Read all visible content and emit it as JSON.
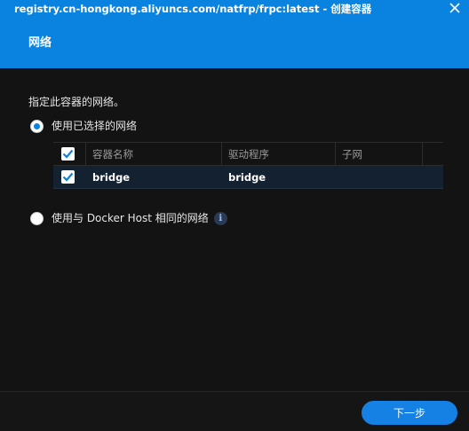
{
  "window": {
    "title": "registry.cn-hongkong.aliyuncs.com/natfrp/frpc:latest - 创建容器",
    "close_glyph": "×"
  },
  "section": {
    "title": "网络"
  },
  "content": {
    "description": "指定此容器的网络。",
    "option_selected_network": "使用已选择的网络",
    "option_host_network": "使用与 Docker Host 相同的网络",
    "info_glyph": "i",
    "table": {
      "columns": [
        "容器名称",
        "驱动程序",
        "子网"
      ],
      "rows": [
        {
          "checked": true,
          "name": "bridge",
          "driver": "bridge",
          "subnet": ""
        }
      ]
    }
  },
  "footer": {
    "next_label": "下一步"
  },
  "colors": {
    "accent": "#0a83e0",
    "button": "#1681e4",
    "background": "#131313",
    "selected_row": "#142130"
  }
}
